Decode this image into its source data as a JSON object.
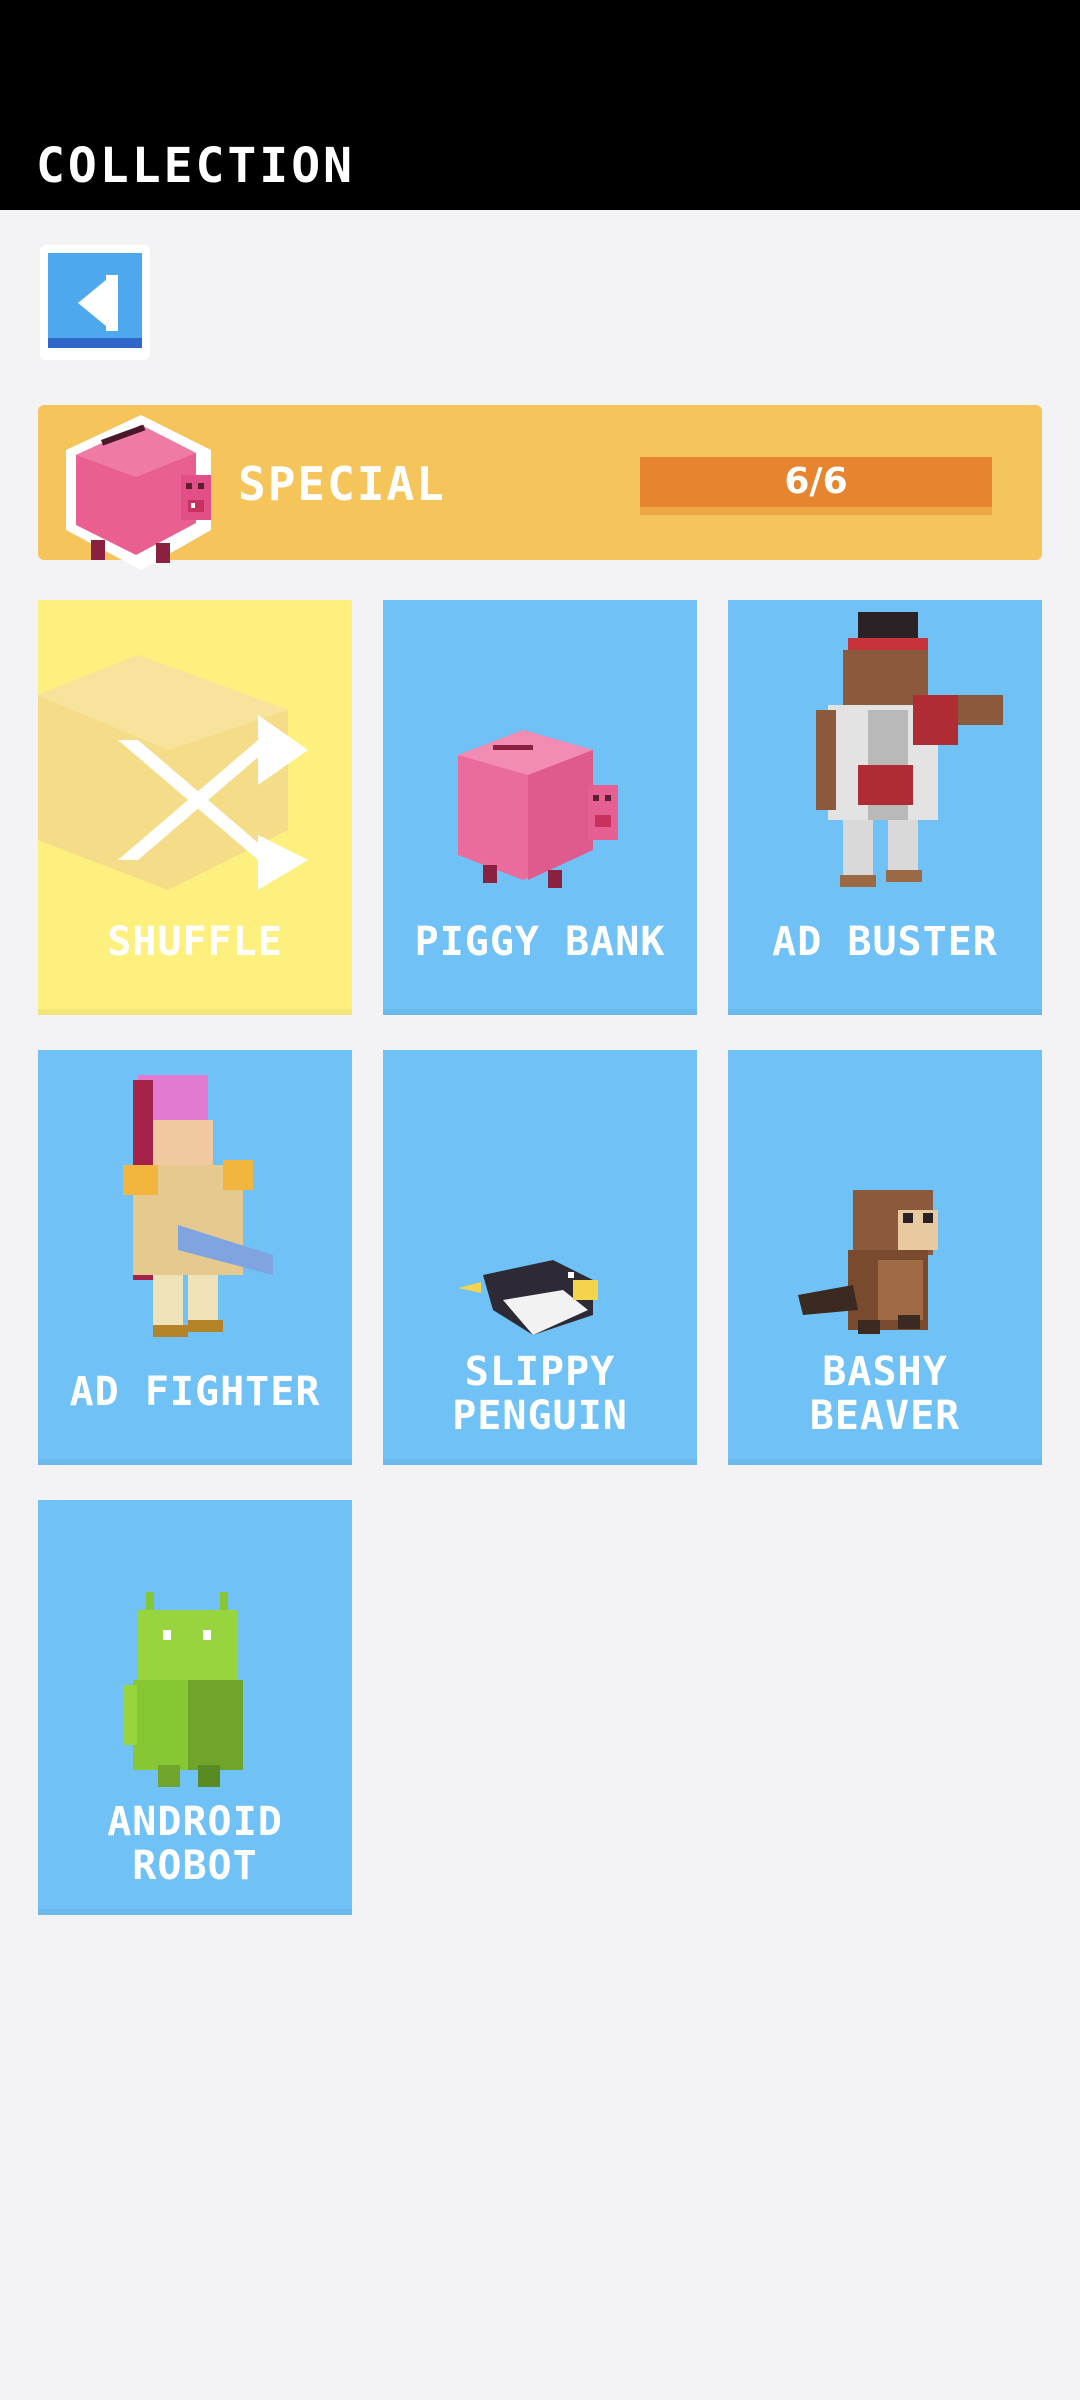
{
  "header": {
    "title": "COLLECTION"
  },
  "back": {
    "icon": "back-arrow-icon"
  },
  "banner": {
    "label": "SPECIAL",
    "progress_text": "6/6",
    "progress_fraction": 1.0,
    "icon": "piggy-bank-icon"
  },
  "cards": [
    {
      "label": "SHUFFLE",
      "icon": "shuffle-icon"
    },
    {
      "label": "PIGGY BANK",
      "icon": "piggy-bank-icon"
    },
    {
      "label": "AD BUSTER",
      "icon": "boxer-icon"
    },
    {
      "label": "AD FIGHTER",
      "icon": "fighter-icon"
    },
    {
      "label": "SLIPPY PENGUIN",
      "icon": "penguin-icon"
    },
    {
      "label": "BASHY BEAVER",
      "icon": "beaver-icon"
    },
    {
      "label": "ANDROID ROBOT",
      "icon": "android-icon"
    }
  ],
  "colors": {
    "header_bg": "#000000",
    "card_bg": "#70c1f5",
    "featured_bg": "#fdf07e",
    "banner_bg": "#f5c45b",
    "progress": "#e6842f"
  }
}
